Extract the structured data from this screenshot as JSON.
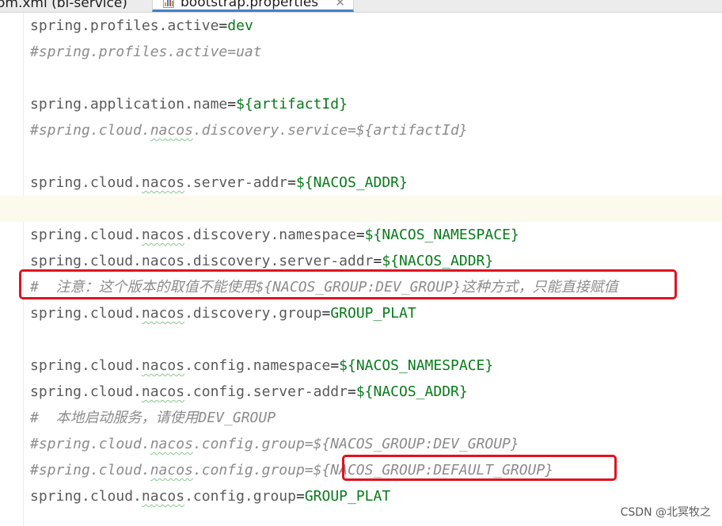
{
  "tabs": [
    {
      "label": "om.xml (bi-service)",
      "active": false
    },
    {
      "label": "bootstrap.properties",
      "active": true,
      "close_glyph": "✕"
    }
  ],
  "editor": {
    "lines": [
      {
        "key": "spring.profiles.active",
        "eq": "=",
        "value": "dev"
      },
      {
        "comment": "#spring.profiles.active=uat"
      },
      {},
      {
        "key": "spring.application.name",
        "eq": "=",
        "value": "${artifactId}"
      },
      {
        "comment_pre": "#spring.cloud.",
        "comment_word": "nacos",
        "comment_post": ".discovery.service=${artifactId}"
      },
      {},
      {
        "key_pre": "spring.cloud.",
        "key_word": "nacos",
        "key_post": ".server-addr",
        "eq": "=",
        "value": "${NACOS_ADDR}"
      },
      {
        "current": true
      },
      {
        "key_pre": "spring.cloud.",
        "key_word": "nacos",
        "key_post": ".discovery.namespace",
        "eq": "=",
        "value": "${NACOS_NAMESPACE}"
      },
      {
        "key_pre": "spring.cloud.",
        "key_word": "nacos",
        "key_post": ".discovery.server-addr",
        "eq": "=",
        "value": "${NACOS_ADDR}"
      },
      {
        "comment": "#  注意：这个版本的取值不能使用${NACOS_GROUP:DEV_GROUP}这种方式，只能直接赋值"
      },
      {
        "key_pre": "spring.cloud.",
        "key_word": "nacos",
        "key_post": ".discovery.group",
        "eq": "=",
        "value": "GROUP_PLAT"
      },
      {},
      {
        "key_pre": "spring.cloud.",
        "key_word": "nacos",
        "key_post": ".config.namespace",
        "eq": "=",
        "value": "${NACOS_NAMESPACE}"
      },
      {
        "key_pre": "spring.cloud.",
        "key_word": "nacos",
        "key_post": ".config.server-addr",
        "eq": "=",
        "value": "${NACOS_ADDR}"
      },
      {
        "comment": "#  本地启动服务，请使用DEV_GROUP"
      },
      {
        "comment_pre": "#spring.cloud.",
        "comment_word": "nacos",
        "comment_post": ".config.group=${NACOS_GROUP:DEV_GROUP}"
      },
      {
        "comment_pre": "#spring.cloud.",
        "comment_word": "nacos",
        "comment_post": ".config.group=${NACOS_GROUP:DEFAULT_GROUP}"
      },
      {
        "key_pre": "spring.cloud.",
        "key_word": "nacos",
        "key_post": ".config.group",
        "eq": "=",
        "value": "GROUP_PLAT"
      }
    ]
  },
  "colors": {
    "key": "#5a5a5a",
    "value": "#087a1b",
    "comment": "#8c8c8c",
    "highlight": "#e1121f",
    "tab_underline": "#4083c9"
  },
  "icons": {
    "file": "properties-file-icon"
  },
  "watermark": "CSDN @北冥牧之"
}
